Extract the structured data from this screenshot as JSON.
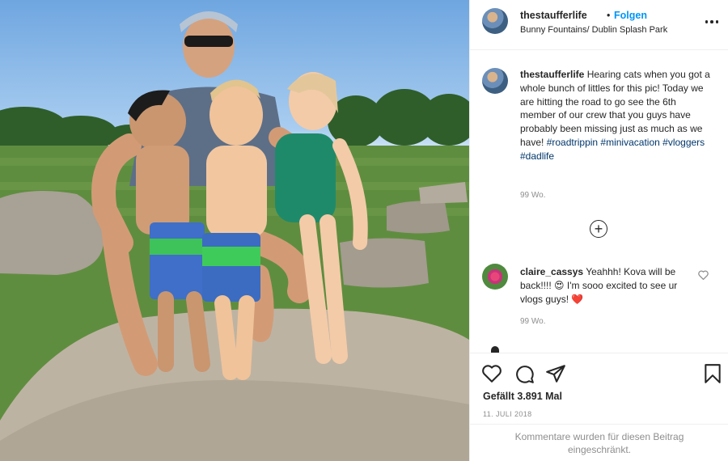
{
  "photo": {
    "alt": ""
  },
  "header": {
    "username": "thestaufferlife",
    "separator": "•",
    "follow_label": "Folgen",
    "location": "Bunny Fountains/ Dublin Splash Park",
    "more_icon": "more-options-icon"
  },
  "caption": {
    "username": "thestaufferlife",
    "text": "Hearing cats when you got a whole bunch of littles for this pic! Today we are hitting the road to go see the 6th member of our crew that you guys have probably been missing just as much as we have! ",
    "hashtags": [
      "#roadtrippin",
      "#minivacation",
      "#vloggers",
      "#dadlife"
    ],
    "time": "99 Wo."
  },
  "load_more_icon": "plus-circle-icon",
  "comment": {
    "username": "claire_cassys",
    "text_before": "Yeahhh! Kova will be back!!!! ",
    "emoji_1": "😍",
    "text_after": " I'm sooo excited to see ur vlogs guys! ",
    "emoji_2": "❤️",
    "time": "99 Wo."
  },
  "actions": {
    "icons": [
      "heart-icon",
      "comment-icon",
      "share-icon",
      "save-icon"
    ],
    "likes": "Gefällt 3.891 Mal",
    "date": "11. JULI 2018"
  },
  "restricted_text": "Kommentare wurden für diesen Beitrag eingeschränkt.",
  "colors": {
    "link": "#0095f6",
    "hashtag": "#00376b",
    "muted": "#8e8e8e",
    "text": "#262626"
  }
}
